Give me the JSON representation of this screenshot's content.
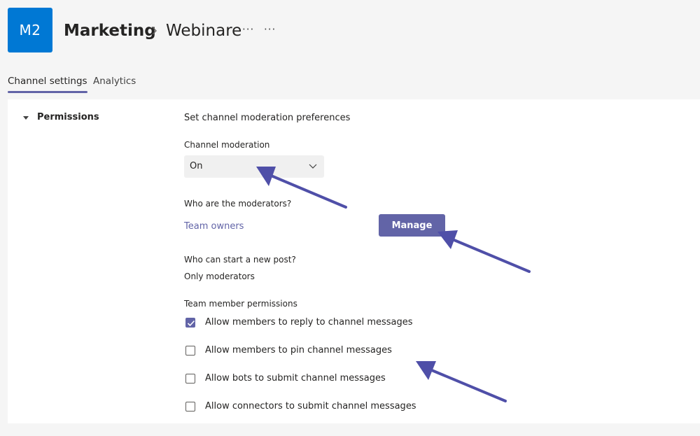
{
  "header": {
    "avatar_initials": "M2",
    "team_name": "Marketing",
    "channel_name": "Webinare",
    "more_label_1": "···",
    "more_label_2": "···",
    "avatar_color": "#0078d4"
  },
  "tabs": [
    {
      "label": "Channel settings",
      "active": true
    },
    {
      "label": "Analytics",
      "active": false
    }
  ],
  "permissions": {
    "section_title": "Permissions",
    "prefs_title": "Set channel moderation preferences",
    "moderation_label": "Channel moderation",
    "moderation_value": "On",
    "who_moderators_label": "Who are the moderators?",
    "moderators_value": "Team owners",
    "manage_label": "Manage",
    "who_post_label": "Who can start a new post?",
    "who_post_value": "Only moderators",
    "member_permissions_label": "Team member permissions",
    "options": [
      {
        "label": "Allow members to reply to channel messages",
        "checked": true
      },
      {
        "label": "Allow members to pin channel messages",
        "checked": false
      },
      {
        "label": "Allow bots to submit channel messages",
        "checked": false
      },
      {
        "label": "Allow connectors to submit channel messages",
        "checked": false
      }
    ]
  },
  "colors": {
    "accent": "#6264a7",
    "annotation_arrow": "#4f4fa8"
  },
  "icons": {
    "breadcrumb": "chevron-right-icon",
    "section_toggle": "caret-down-icon",
    "dropdown": "chevron-down-icon",
    "checkbox_mark": "checkmark-icon",
    "annotation": "arrow-icon"
  }
}
